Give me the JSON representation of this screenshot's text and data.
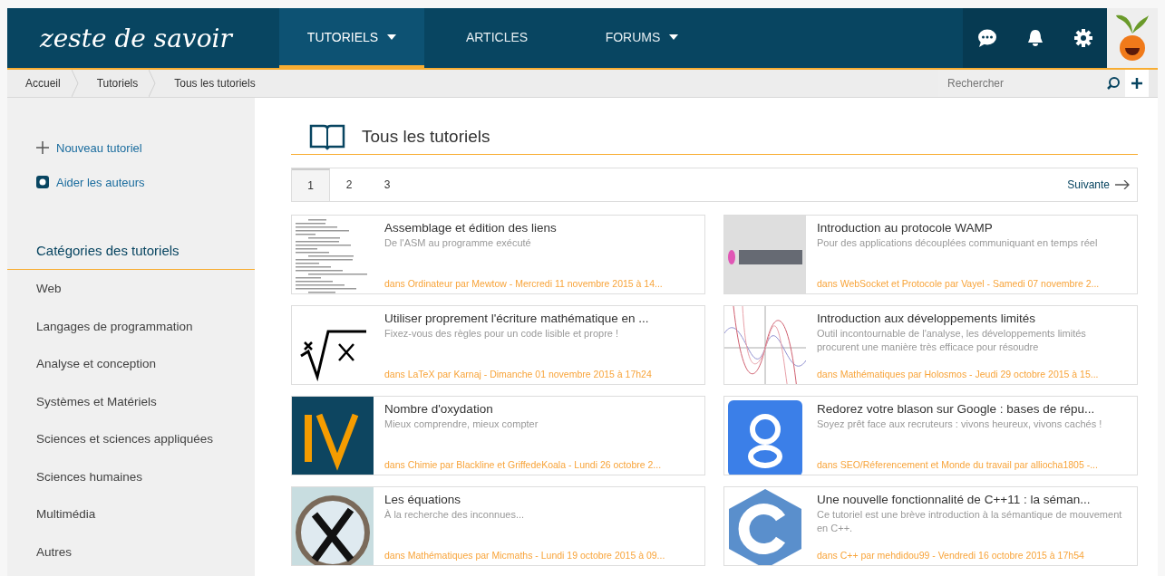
{
  "header": {
    "logo": "zeste de savoir",
    "nav": [
      {
        "label": "TUTORIELS",
        "selected": true,
        "dropdown": true
      },
      {
        "label": "ARTICLES",
        "selected": false,
        "dropdown": false
      },
      {
        "label": "FORUMS",
        "selected": false,
        "dropdown": true
      }
    ]
  },
  "breadcrumb": [
    "Accueil",
    "Tutoriels",
    "Tous les tutoriels"
  ],
  "search": {
    "placeholder": "Rechercher"
  },
  "sidebar": {
    "actions": [
      {
        "kind": "plus",
        "label": "Nouveau tutoriel"
      },
      {
        "kind": "help",
        "label": "Aider les auteurs"
      }
    ],
    "categories_title": "Catégories des tutoriels",
    "categories": [
      "Web",
      "Langages de programmation",
      "Analyse et conception",
      "Systèmes et Matériels",
      "Sciences et sciences appliquées",
      "Sciences humaines",
      "Multimédia",
      "Autres"
    ]
  },
  "main": {
    "title": "Tous les tutoriels",
    "pages": [
      {
        "label": "1",
        "selected": true
      },
      {
        "label": "2",
        "selected": false
      },
      {
        "label": "3",
        "selected": false
      }
    ],
    "next": "Suivante",
    "tutorials": [
      {
        "kind": "code",
        "title": "Assemblage et édition des liens",
        "description": "De l'ASM au programme exécuté",
        "meta": "dans Ordinateur par Mewtow - Mercredi 11 novembre 2015 à 14..."
      },
      {
        "kind": "wamp",
        "title": "Introduction au protocole WAMP",
        "description": "Pour des applications découplées communiquant en temps réel",
        "meta": "dans WebSocket et Protocole par Vayel - Samedi 07 novembre 2..."
      },
      {
        "kind": "root",
        "title": "Utiliser proprement l'écriture mathématique en ...",
        "description": "Fixez-vous des règles pour un code lisible et propre !",
        "meta": "dans LaTeX par Karnaj - Dimanche 01 novembre 2015 à 17h24"
      },
      {
        "kind": "curves",
        "title": "Introduction aux développements limités",
        "description": "Outil incontournable de l'analyse, les développements limités procurent une manière très efficace pour résoudre",
        "meta": "dans Mathématiques par Holosmos - Jeudi 29 octobre 2015 à 15..."
      },
      {
        "kind": "numeral",
        "title": "Nombre d'oxydation",
        "description": "Mieux comprendre, mieux compter",
        "meta": "dans Chimie par Blackline et GriffedeKoala - Lundi 26 octobre 2..."
      },
      {
        "kind": "g",
        "title": "Redorez votre blason sur Google : bases de répu...",
        "description": "Soyez prêt face aux recruteurs : vivons heureux, vivons cachés !",
        "meta": "dans SEO/Réferencement et Monde du travail par alliocha1805 -..."
      },
      {
        "kind": "magnifier",
        "title": "Les équations",
        "description": "À la recherche des inconnues...",
        "meta": "dans Mathématiques par Micmaths - Lundi 19 octobre 2015 à 09..."
      },
      {
        "kind": "hexagon",
        "title": "Une nouvelle fonctionnalité de C++11 : la séman...",
        "description": "Ce tutoriel est une brève introduction à la sémantique de mouvement en C++.",
        "meta": "dans C++ par mehdidou99 - Vendredi 16 octobre 2015 à 17h54"
      }
    ]
  }
}
